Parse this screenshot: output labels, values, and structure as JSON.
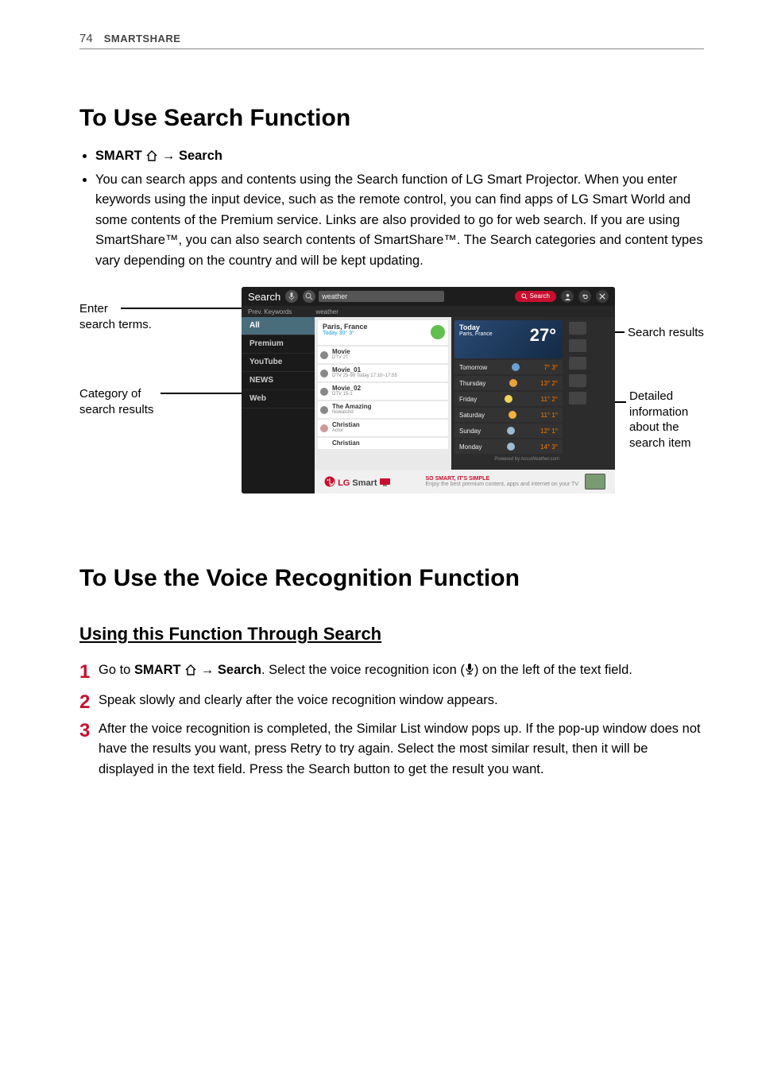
{
  "header": {
    "page_number": "74",
    "section": "SMARTSHARE"
  },
  "section1": {
    "title": "To Use Search Function",
    "bullet1_label": "SMART",
    "bullet1_arrow": "→",
    "bullet1_target": "Search",
    "bullet2": "You can search apps and contents using the Search function of LG Smart Projector. When you enter keywords using the input device, such as the remote control, you can find apps of LG Smart World and some contents of the Premium service. Links are also provided to go for web search. If you are using SmartShare™, you can also search contents of SmartShare™. The Search categories and content types vary depending on the country and will be kept updating."
  },
  "figure": {
    "labels": {
      "enter_terms_l1": "Enter",
      "enter_terms_l2": "search terms.",
      "category_l1": "Category of",
      "category_l2": "search results",
      "results": "Search results",
      "detail_l1": "Detailed",
      "detail_l2": "information",
      "detail_l3": "about the",
      "detail_l4": "search item"
    },
    "app": {
      "topbar": {
        "title": "Search",
        "search_value": "weather",
        "button_label": "Search"
      },
      "prev_keywords_label": "Prev. Keywords",
      "prev_keywords_value": "weather",
      "sidebar": {
        "items": [
          "All",
          "Premium",
          "YouTube",
          "NEWS",
          "Web"
        ],
        "active_index": 0
      },
      "col_a": {
        "hero_title": "Paris, France",
        "hero_sub": "Today   30°  3°",
        "rows": [
          {
            "t1": "Movie",
            "t2": "DTV 2T"
          },
          {
            "t1": "Movie_01",
            "t2": "DTV 25-99   Today 17:10~17:55"
          },
          {
            "t1": "Movie_02",
            "t2": "DTV 15-1"
          },
          {
            "t1": "The Amazing",
            "t2": "Nowatchd"
          },
          {
            "t1": "Christian",
            "t2": "Actor"
          },
          {
            "t1": "Christian",
            "t2": ""
          }
        ]
      },
      "col_b": {
        "hero_t1": "Today",
        "hero_t2": "Paris, France",
        "hero_num": "27°",
        "rows": [
          {
            "day": "Tomorrow",
            "color": "#6aa0d8",
            "temp": "7° 3°"
          },
          {
            "day": "Thursday",
            "color": "#e6a23c",
            "temp": "13° 2°"
          },
          {
            "day": "Friday",
            "color": "#f2d35b",
            "temp": "11° 2°"
          },
          {
            "day": "Saturday",
            "color": "#f2b23c",
            "temp": "11° 1°"
          },
          {
            "day": "Sunday",
            "color": "#9bbbd4",
            "temp": "12° 1°"
          },
          {
            "day": "Monday",
            "color": "#9bbbd4",
            "temp": "14° 3°"
          }
        ],
        "powered": "Powered by AccuWeather.com"
      },
      "footer": {
        "logo_brand": "LG",
        "logo_text": "Smart",
        "tagline_l1": "SO SMART, IT'S SIMPLE",
        "tagline_l2": "Enjoy the best premium content, apps and internet on your TV"
      }
    }
  },
  "section2": {
    "title": "To Use the Voice Recognition Function",
    "subheading": "Using this Function Through Search",
    "steps": {
      "s1_pre": "Go to ",
      "s1_smart": "SMART",
      "s1_arrow": " → ",
      "s1_search": "Search",
      "s1_post": ". Select the voice recognition icon (",
      "s1_tail": ") on the left of the text field.",
      "s2": "Speak slowly and clearly after the voice recognition window appears.",
      "s3": "After the voice recognition is completed, the Similar List window pops up. If the pop-up window does not have the results you want, press Retry to try again. Select the most similar result, then it will be displayed in the text field. Press the Search button to get the result you want."
    }
  }
}
